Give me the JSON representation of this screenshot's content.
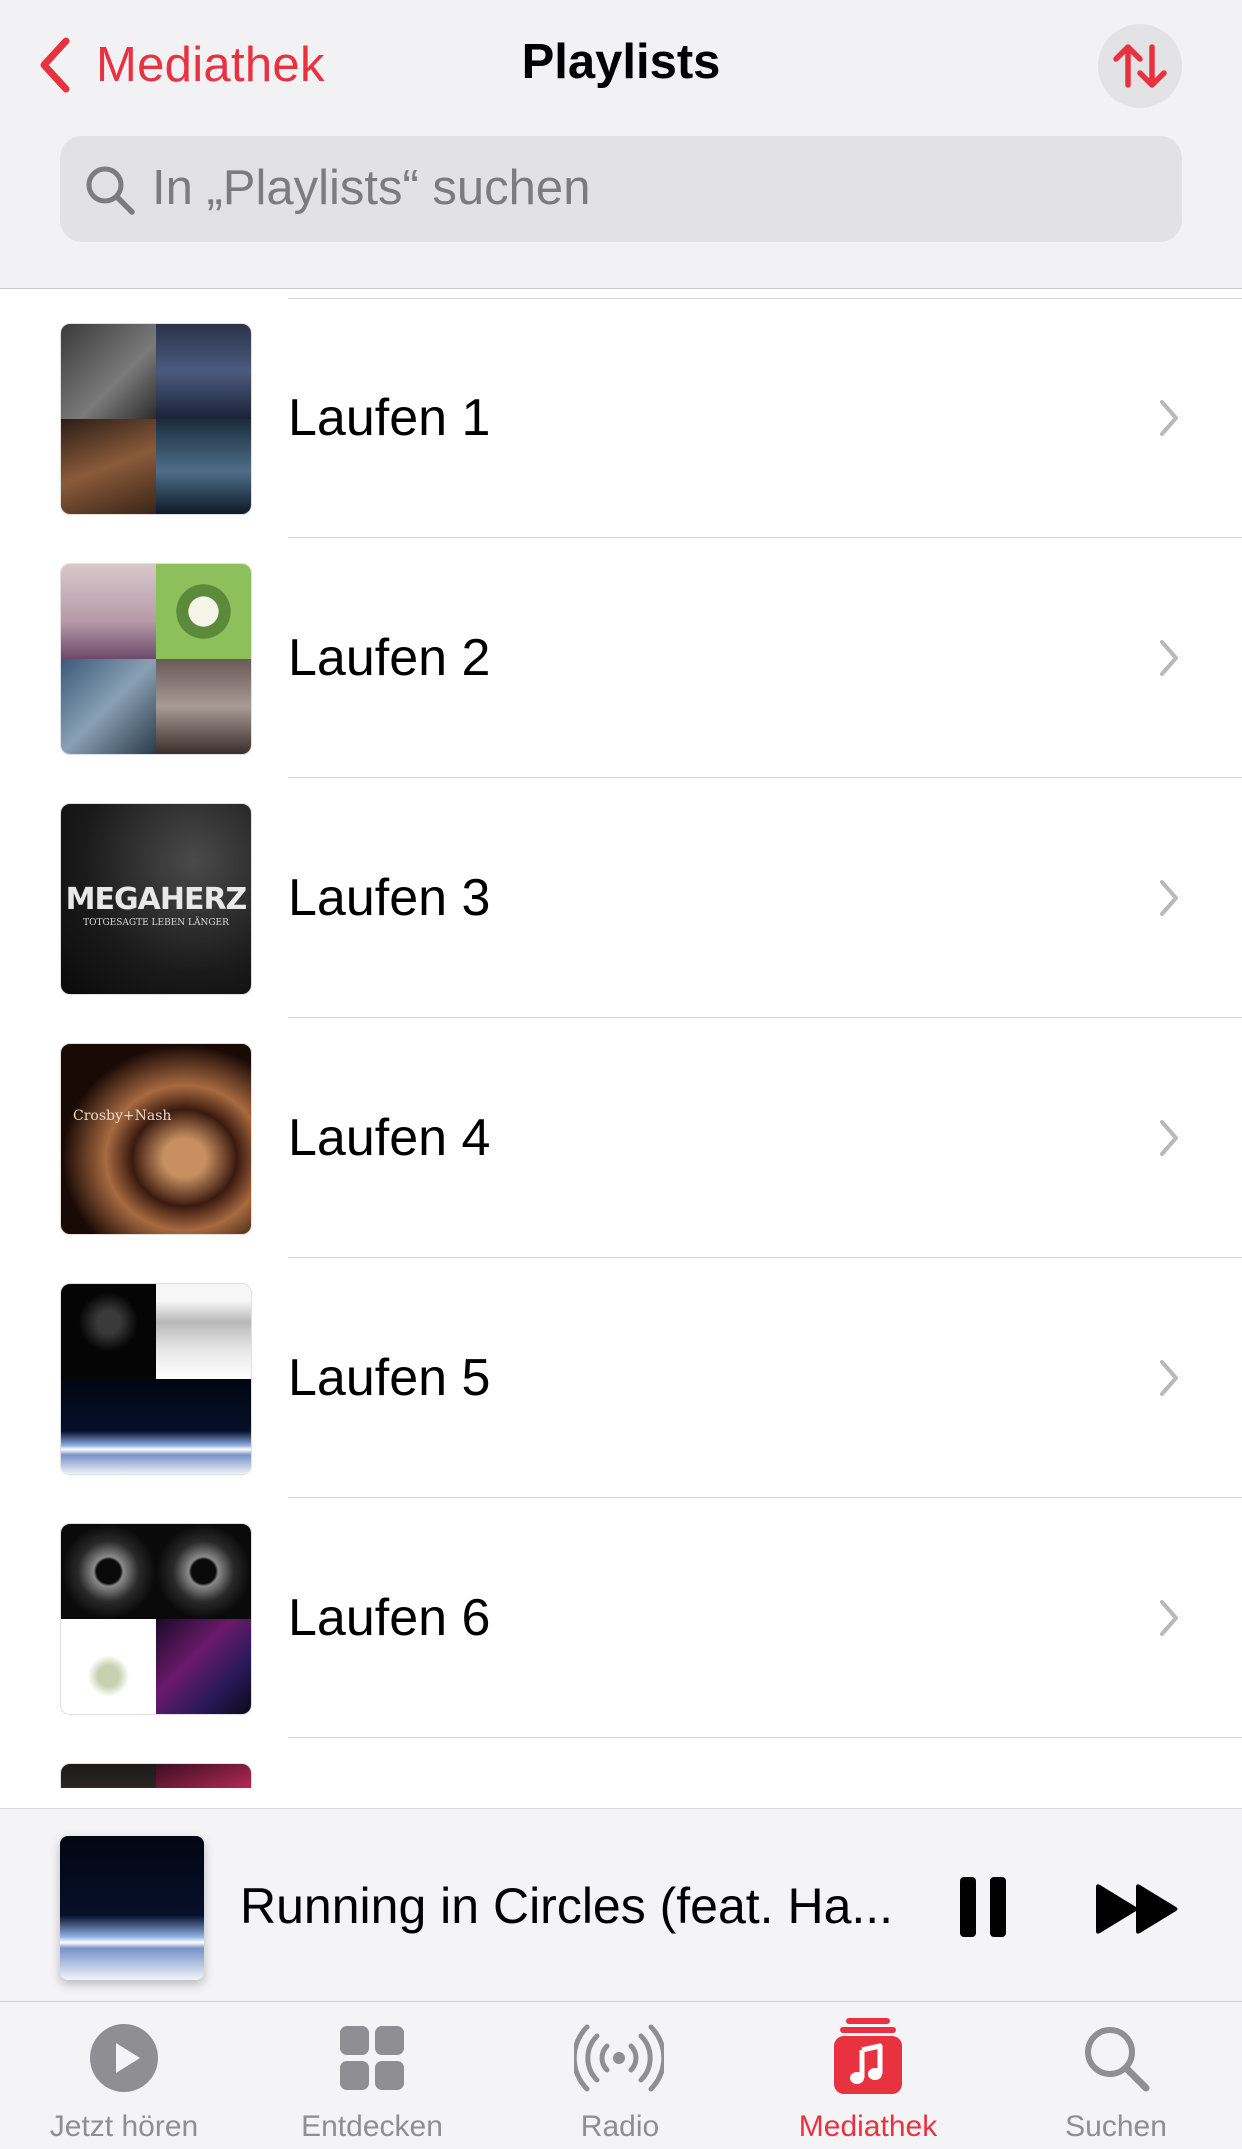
{
  "header": {
    "back_label": "Mediathek",
    "title": "Playlists",
    "sort_icon": "sort-arrows-icon",
    "accent": "#e8323f"
  },
  "search": {
    "placeholder": "In „Playlists“ suchen"
  },
  "playlists": [
    {
      "name": "Laufen 1"
    },
    {
      "name": "Laufen 2"
    },
    {
      "name": "Laufen 3"
    },
    {
      "name": "Laufen 4"
    },
    {
      "name": "Laufen 5"
    },
    {
      "name": "Laufen 6"
    }
  ],
  "artwork_text": {
    "laufen3": "MEGAHERZ",
    "laufen3_sub": "TOTGESAGTE LEBEN LÄNGER",
    "laufen4": "Crosby+Nash"
  },
  "player": {
    "title": "Running in Circles (feat. Ha...",
    "state": "playing"
  },
  "tabs": [
    {
      "label": "Jetzt hören",
      "icon": "play-circle-icon"
    },
    {
      "label": "Entdecken",
      "icon": "grid-icon"
    },
    {
      "label": "Radio",
      "icon": "radio-waves-icon"
    },
    {
      "label": "Mediathek",
      "icon": "music-library-icon",
      "active": true
    },
    {
      "label": "Suchen",
      "icon": "search-icon"
    }
  ]
}
